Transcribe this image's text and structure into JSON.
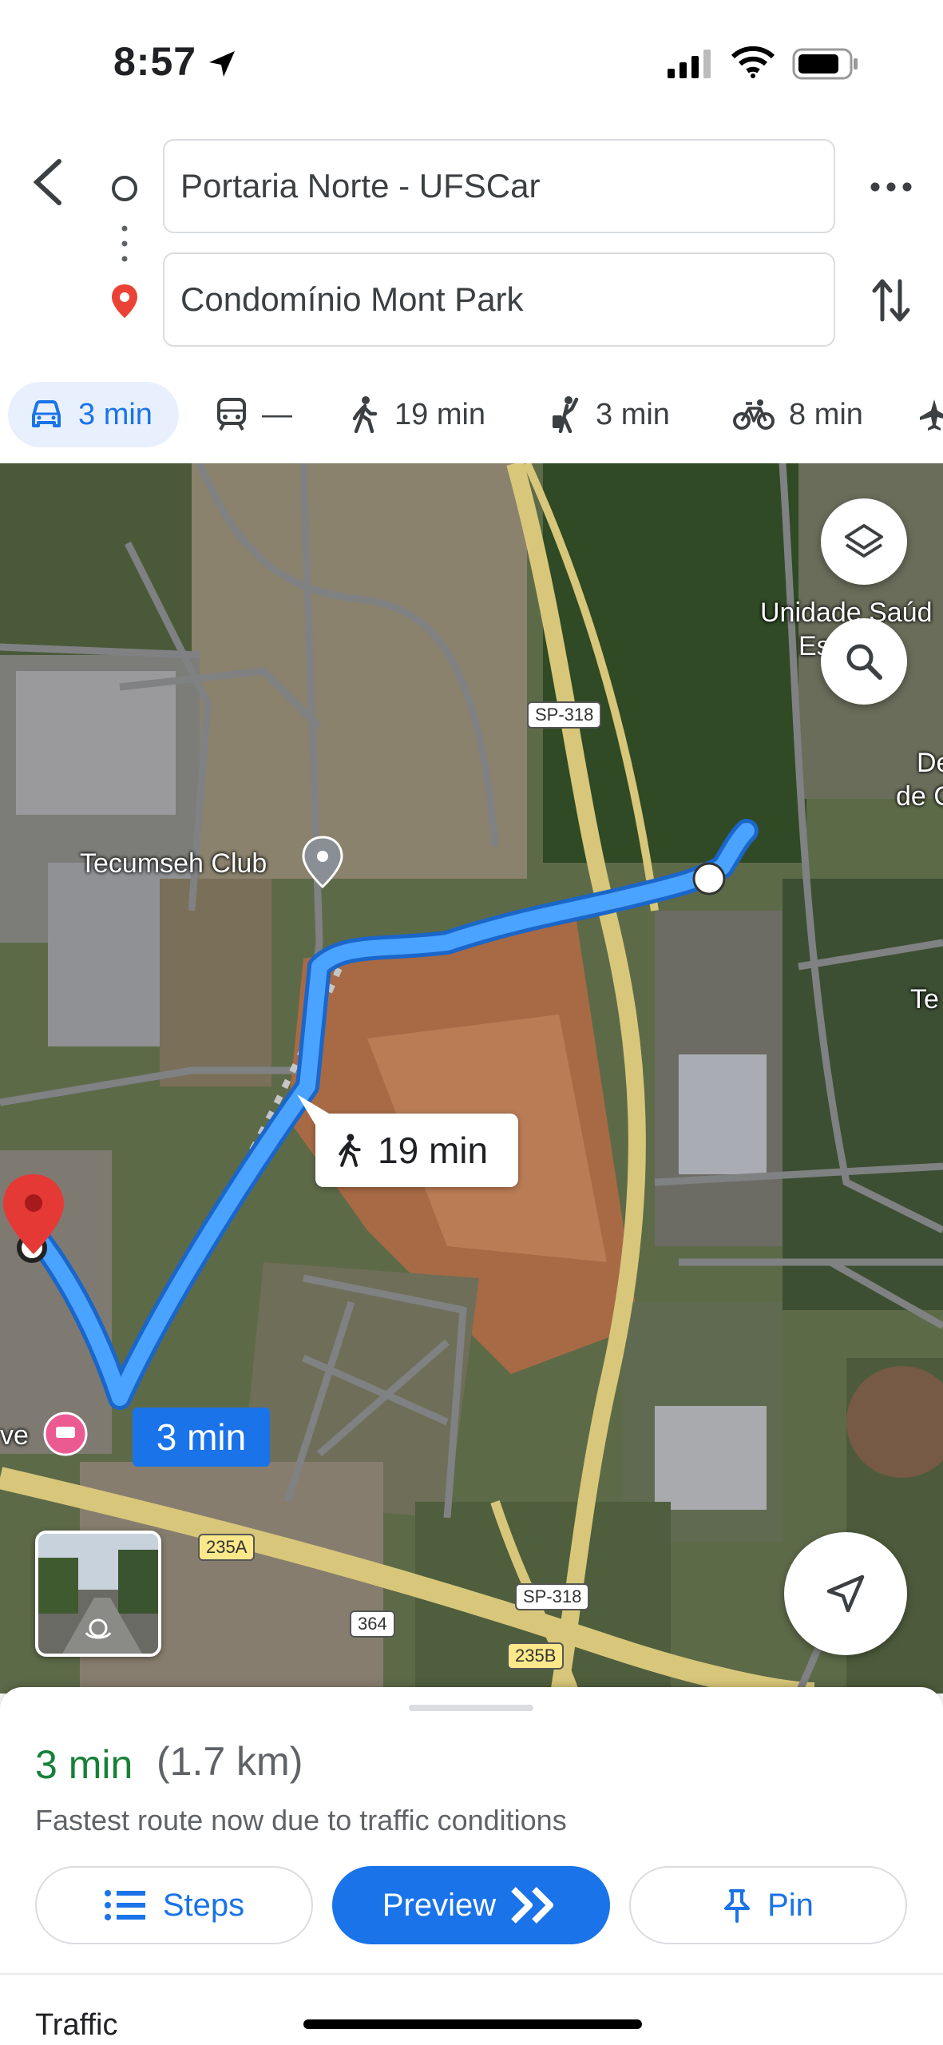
{
  "status": {
    "time": "8:57"
  },
  "route": {
    "origin": "Portaria Norte - UFSCar",
    "destination": "Condomínio Mont Park"
  },
  "modes": [
    {
      "icon": "car-icon",
      "label": "3 min",
      "active": true
    },
    {
      "icon": "transit-icon",
      "label": "—"
    },
    {
      "icon": "walk-icon",
      "label": "19 min"
    },
    {
      "icon": "rideshare-icon",
      "label": "3 min"
    },
    {
      "icon": "bike-icon",
      "label": "8 min"
    }
  ],
  "map": {
    "labels": {
      "tecumseh": "Tecumseh Club",
      "unidade": "Unidade Saúd",
      "unidade2": "Es      USI",
      "de": "De",
      "dec": "de C",
      "te": "Te",
      "hotel": "ve"
    },
    "shields": {
      "sp318_top": "SP-318",
      "sp318_bottom": "SP-318",
      "r235a": "235A",
      "r235b": "235B",
      "r364": "364"
    },
    "walk_callout": "19 min",
    "drive_label": "3 min"
  },
  "summary": {
    "time": "3 min",
    "distance": "(1.7 km)",
    "note": "Fastest route now due to traffic conditions"
  },
  "actions": {
    "steps": "Steps",
    "preview": "Preview",
    "pin": "Pin"
  },
  "traffic_label": "Traffic",
  "colors": {
    "accent": "#1a73e8",
    "time_green": "#188038",
    "route_blue": "#4285f4"
  }
}
